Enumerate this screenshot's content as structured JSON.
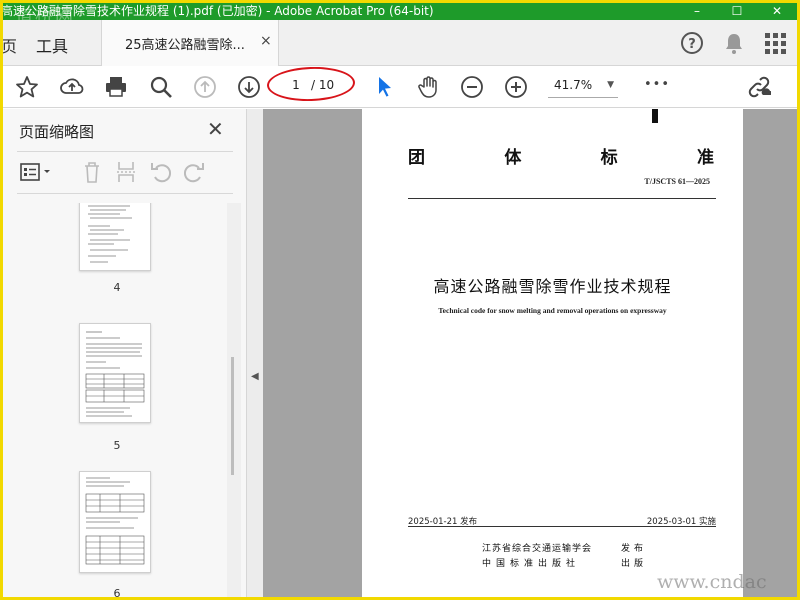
{
  "window": {
    "title": "高速公路融雪除雪技术作业规程 (1).pdf (已加密) - Adobe Acrobat Pro (64-bit)",
    "watermark_top": "道桥网",
    "controls": [
      "–",
      "☐",
      "✕"
    ]
  },
  "menu": {
    "home_stub": "页",
    "tools": "工具",
    "doc_tab": "25高速公路融雪除...",
    "doc_tab_close": "×"
  },
  "toolbar": {
    "page_current": "1",
    "page_total": "/ 10",
    "zoom": "41.7%",
    "more": "•••",
    "highlight_color": "#d8141a",
    "accent_color": "#1473e6"
  },
  "sidebar": {
    "title": "页面缩略图",
    "close": "✕",
    "thumbnails": [
      {
        "page": "4"
      },
      {
        "page": "5"
      },
      {
        "page": "6"
      }
    ]
  },
  "document": {
    "org_chars": [
      "团",
      "体",
      "标",
      "准"
    ],
    "code": "T/JSCTS 61—2025",
    "title_zh": "高速公路融雪除雪作业技术规程",
    "title_en": "Technical code for snow melting and removal operations on expressway",
    "publish_date": "2025-01-21 发布",
    "implement_date": "2025-03-01 实施",
    "issuer_line1": "江苏省综合交通运输学会",
    "issuer_line2": "中国标准出版社",
    "action1": "发布",
    "action2": "出版"
  },
  "watermark_bottom": "www.cndac"
}
